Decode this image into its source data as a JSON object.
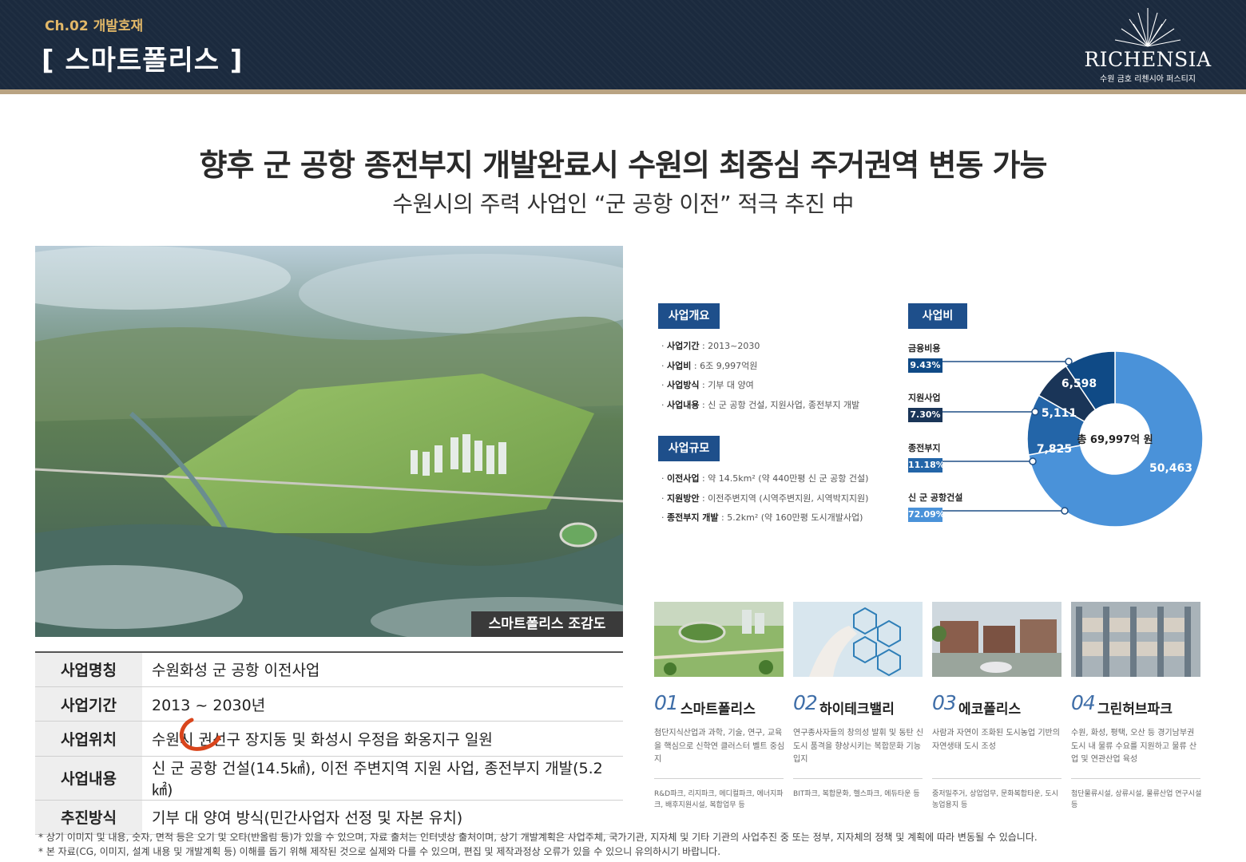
{
  "header": {
    "chapter": "Ch.02 개발호재",
    "section_title": "[ 스마트폴리스 ]",
    "logo_text": "RICHENSIA",
    "logo_sub": "수원 금호 리첸시아 퍼스티지"
  },
  "headline": "향후 군 공항 종전부지 개발완료시 수원의 최중심 주거권역 변동 가능",
  "subheadline": "수원시의 주력 사업인 “군 공항 이전” 적극 추진 中",
  "aerial": {
    "caption": "스마트폴리스 조감도"
  },
  "info_table": [
    {
      "key": "사업명칭",
      "value": "수원화성 군 공항 이전사업"
    },
    {
      "key": "사업기간",
      "value": "2013 ~ 2030년"
    },
    {
      "key": "사업위치",
      "value": "수원시 권선구 장지동 및 화성시 우정읍 화옹지구 일원"
    },
    {
      "key": "사업내용",
      "value": "신 군 공항 건설(14.5㎢), 이전 주변지역 지원 사업, 종전부지 개발(5.2㎢)"
    },
    {
      "key": "추진방식",
      "value": "기부 대 양여 방식(민간사업자 선정 및 자본 유치)"
    }
  ],
  "overview": {
    "label": "사업개요",
    "items": [
      {
        "k": "사업기간",
        "v": " : 2013~2030"
      },
      {
        "k": "사업비",
        "v": " : 6조 9,997억원"
      },
      {
        "k": "사업방식",
        "v": " : 기부 대 양여"
      },
      {
        "k": "사업내용",
        "v": " : 신 군 공항 건설, 지원사업, 종전부지 개발"
      }
    ]
  },
  "scale": {
    "label": "사업규모",
    "items": [
      {
        "k": "이전사업",
        "v": " : 약 14.5km² (약 440만평 신 군 공항 건설)"
      },
      {
        "k": "지원방안",
        "v": " : 이전주변지역 (시역주변지원, 시역박지지원)"
      },
      {
        "k": "종전부지 개발",
        "v": " : 5.2km² (약 160만평 도시개발사업)"
      }
    ]
  },
  "cost": {
    "label": "사업비",
    "total_label": "총 69,997억 원",
    "items": [
      {
        "name": "금융비용",
        "pct": "9.43%",
        "value": "6,598",
        "color": "#0f4a86"
      },
      {
        "name": "지원사업",
        "pct": "7.30%",
        "value": "5,111",
        "color": "#1a3558"
      },
      {
        "name": "종전부지",
        "pct": "11.18%",
        "value": "7,825",
        "color": "#2365a8"
      },
      {
        "name": "신 군 공항건설",
        "pct": "72.09%",
        "value": "50,463",
        "color": "#4a92d9"
      }
    ]
  },
  "cards": [
    {
      "num": "01",
      "title": "스마트폴리스",
      "desc": "첨단지식산업과 과학, 기술, 연구, 교육을 핵심으로 신학연 클러스터 벨트 중심지",
      "sub": "R&D파크, 리지파크, 메디컬파크, 에너지파크, 배후지원시설, 복합업무 등"
    },
    {
      "num": "02",
      "title": "하이테크밸리",
      "desc": "연구종사자들의 창의성 발휘 및 동탄 신도시 품격을 향상시키는 복합문화 기능 입지",
      "sub": "BIT파크, 복합문화, 헬스파크, 에듀타운 등"
    },
    {
      "num": "03",
      "title": "에코폴리스",
      "desc": "사람과 자연이 조화된 도시농업 기반의 자연생태 도시 조성",
      "sub": "중저밀주거, 상업업무, 문화복합타운, 도시농업용지 등"
    },
    {
      "num": "04",
      "title": "그린허브파크",
      "desc": "수원, 화성, 평택, 오산 등 경기남부권 도시 내 물류 수요를 지원하고 물류 산업 및 연관산업 육성",
      "sub": "첨단물류시설, 상류시설, 물류산업 연구시설 등"
    }
  ],
  "notes": [
    "* 상기 이미지 및 내용, 숫자, 면적 등은 오기 및 오타(반올림 등)가 있을 수 있으며, 자료 출처는 인터넷상 출처이며, 상기 개발계획은 사업주체, 국가기관, 지자체 및 기타 기관의 사업추진 중 또는 정부, 지자체의 정책 및 계획에 따라 변동될 수 있습니다.",
    "* 본 자료(CG, 이미지, 설계 내용 및 개발계획 등) 이해를 돕기 위해 제작된 것으로 실제와 다를 수 있으며, 편집 및 제작과정상 오류가 있을 수 있으니 유의하시기 바랍니다."
  ]
}
